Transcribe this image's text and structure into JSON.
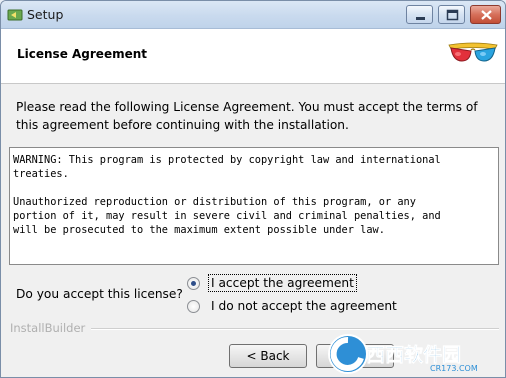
{
  "window": {
    "title": "Setup",
    "controls": {
      "minimize": "minimize",
      "maximize": "maximize",
      "close": "close"
    }
  },
  "header": {
    "title": "License Agreement",
    "logo_icon": "3d-glasses-icon"
  },
  "intro_text": "Please read the following License Agreement. You must accept the terms of this agreement before continuing with the installation.",
  "license_text": "WARNING: This program is protected by copyright law and international\ntreaties.\n\nUnauthorized reproduction or distribution of this program, or any\nportion of it, may result in severe civil and criminal penalties, and\nwill be prosecuted to the maximum extent possible under law.",
  "acceptance": {
    "question": "Do you accept this license?",
    "options": [
      {
        "label": "I accept the agreement",
        "selected": true
      },
      {
        "label": "I do not accept the agreement",
        "selected": false
      }
    ]
  },
  "footer": {
    "brand": "InstallBuilder",
    "back_label": "< Back",
    "next_label": "Ne",
    "watermark": {
      "brand_cn": "西西软件园",
      "url": "CR173.COM"
    }
  }
}
